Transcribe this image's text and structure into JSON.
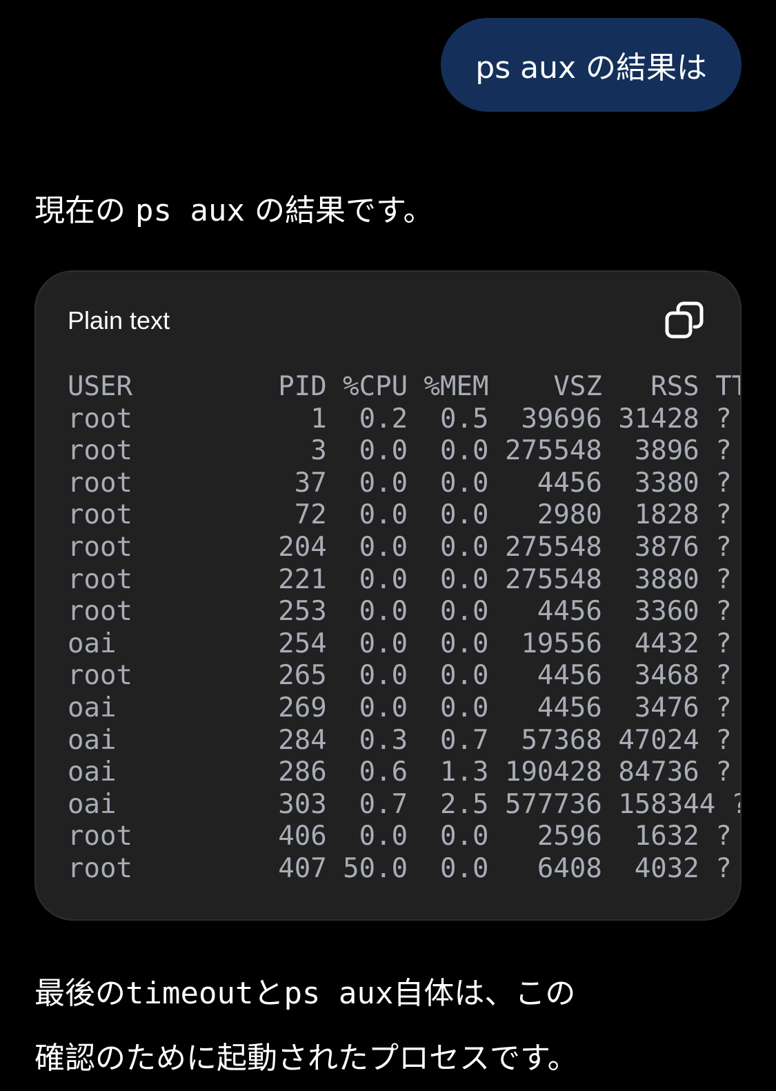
{
  "user_message": "ps aux の結果は",
  "assistant": {
    "intro": {
      "before": "現在の",
      "code": "ps aux",
      "after": "の結果です。"
    },
    "code_block": {
      "language_label": "Plain text",
      "copy_icon": "copy-icon",
      "lines": [
        "USER         PID %CPU %MEM    VSZ   RSS TTY",
        "root           1  0.2  0.5  39696 31428 ?",
        "root           3  0.0  0.0 275548  3896 ?",
        "root          37  0.0  0.0   4456  3380 ?",
        "root          72  0.0  0.0   2980  1828 ?",
        "root         204  0.0  0.0 275548  3876 ?",
        "root         221  0.0  0.0 275548  3880 ?",
        "root         253  0.0  0.0   4456  3360 ?",
        "oai          254  0.0  0.0  19556  4432 ?",
        "root         265  0.0  0.0   4456  3468 ?",
        "oai          269  0.0  0.0   4456  3476 ?",
        "oai          284  0.3  0.7  57368 47024 ?",
        "oai          286  0.6  1.3 190428 84736 ?",
        "oai          303  0.7  2.5 577736 158344 ?",
        "root         406  0.0  0.0   2596  1632 ?",
        "root         407 50.0  0.0   6408  4032 ?"
      ]
    },
    "outro": {
      "p1": "最後の",
      "c1": "timeout",
      "p2": "と",
      "c2": "ps aux",
      "p3": "自体は、この",
      "line2": "確認のために起動されたプロセスです。"
    }
  }
}
